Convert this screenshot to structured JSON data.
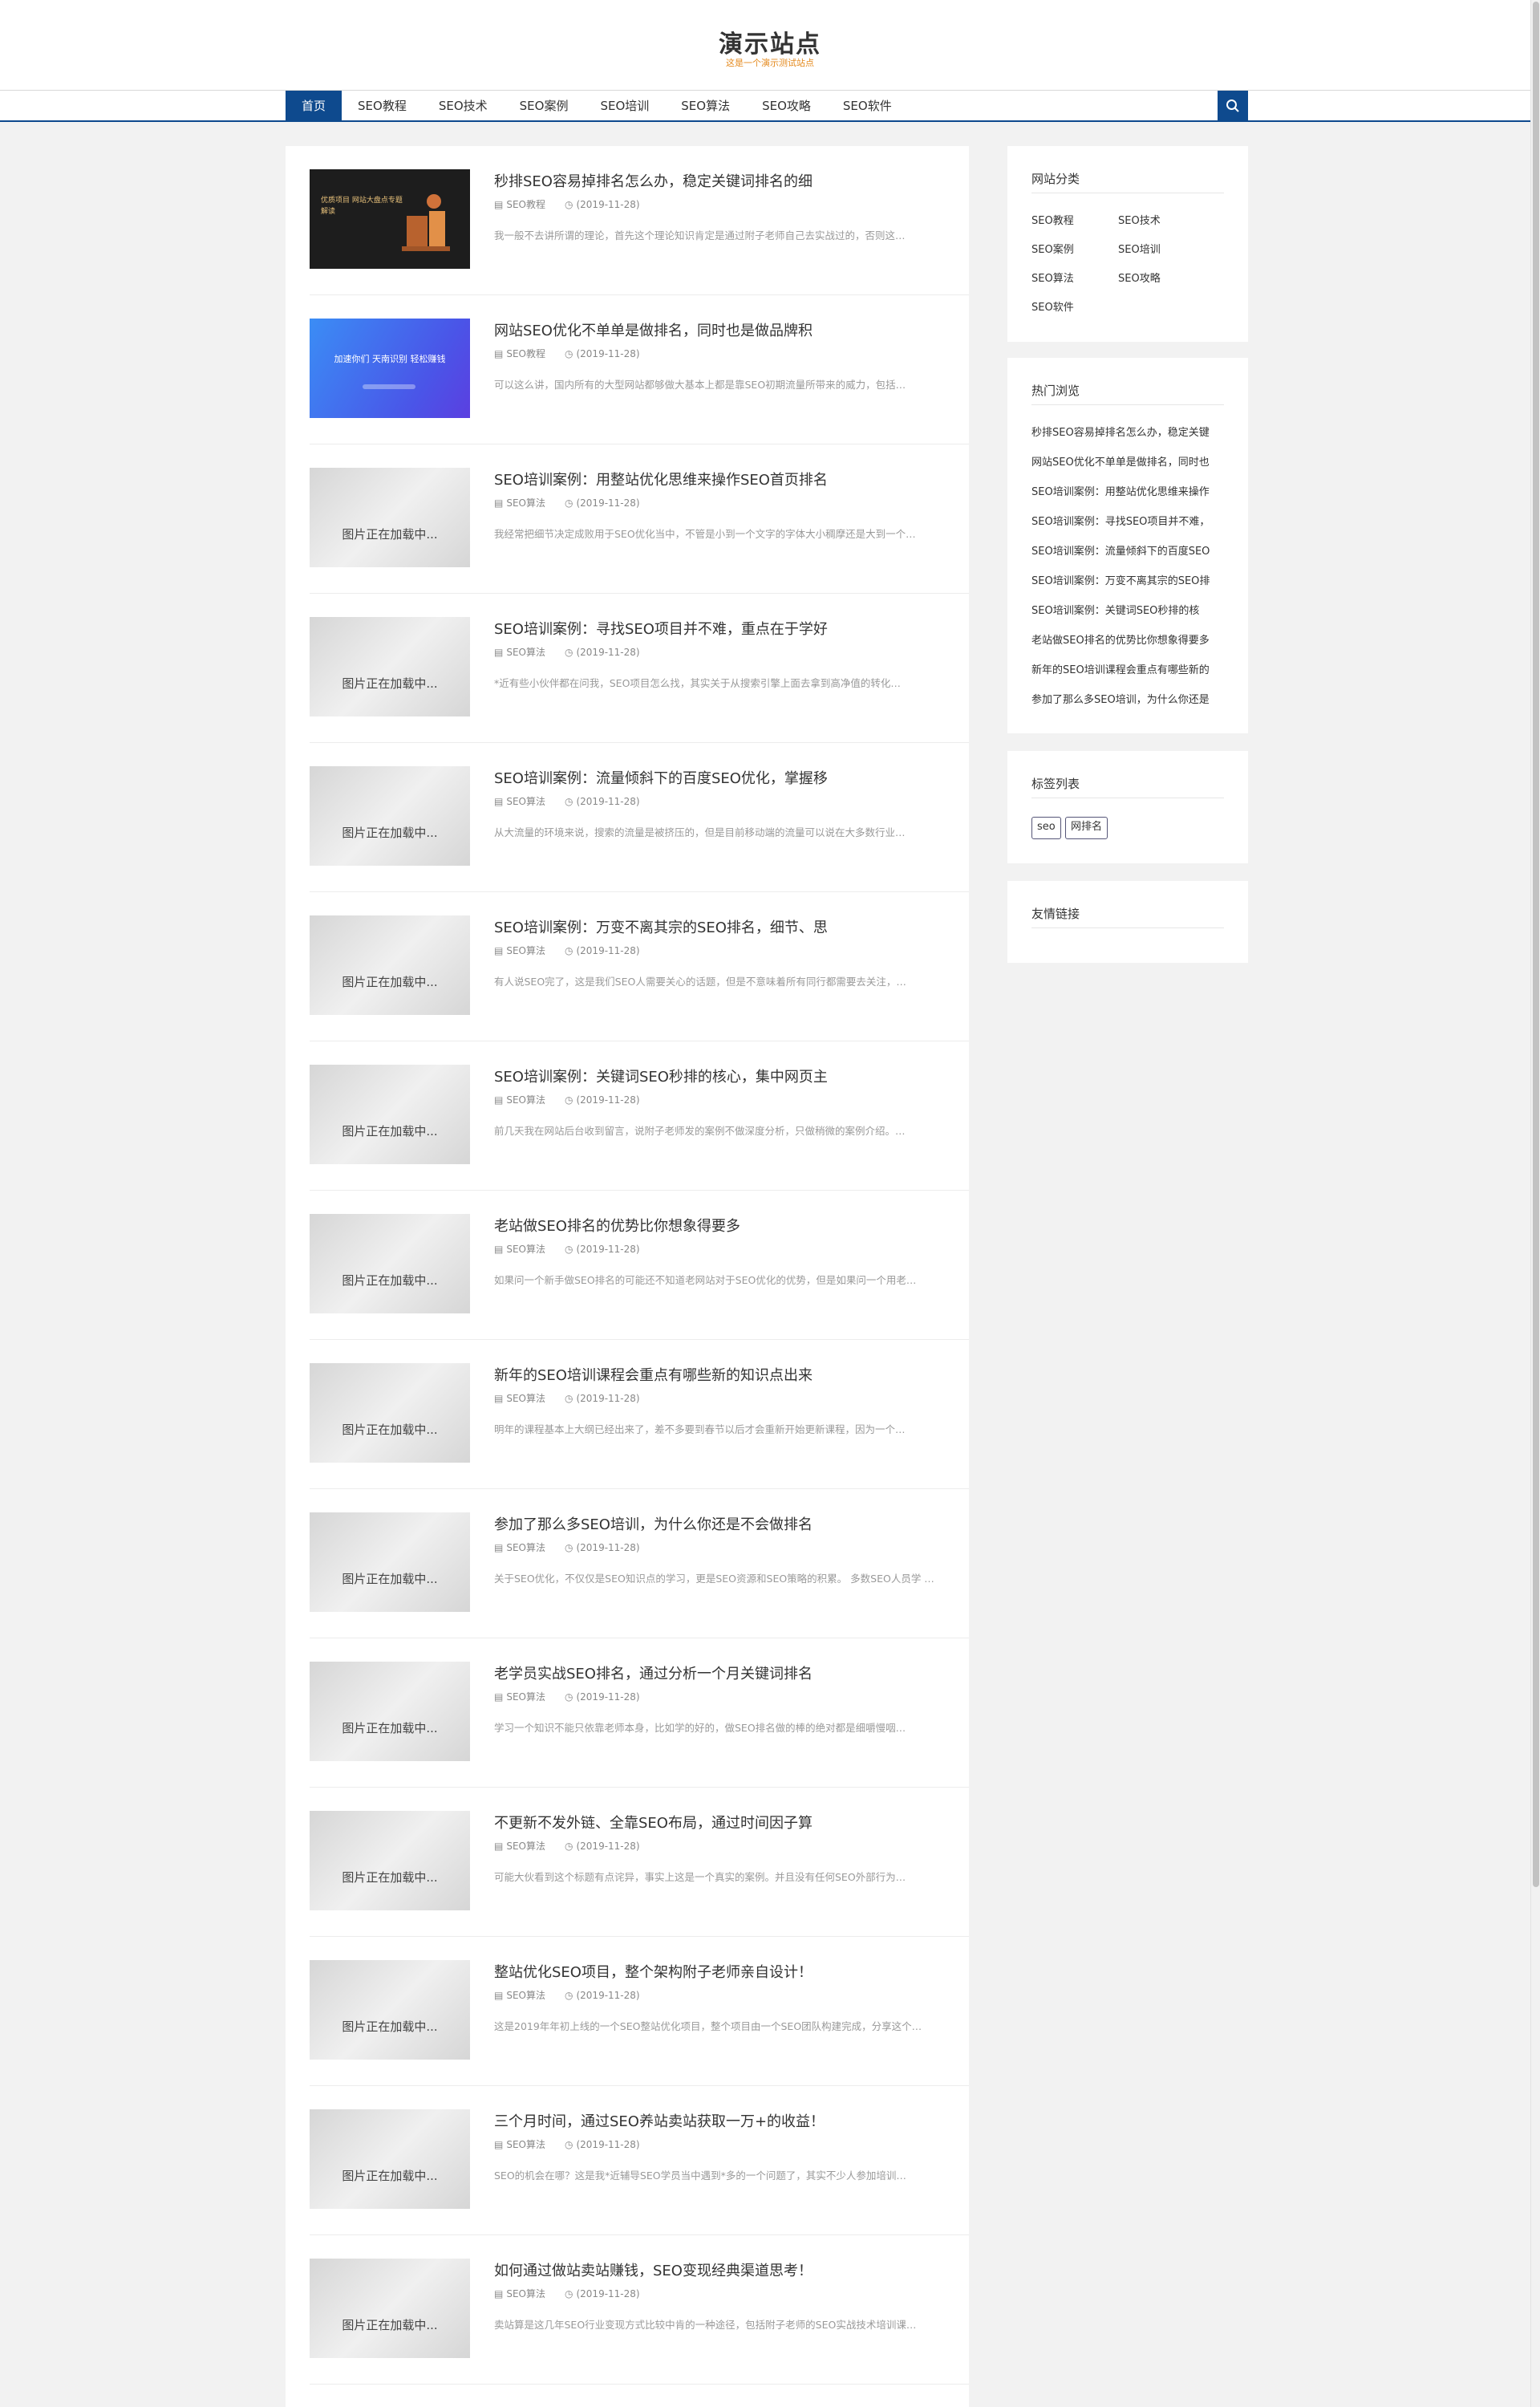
{
  "site": {
    "title": "演示站点",
    "subtitle": "这是一个演示测试站点"
  },
  "nav": {
    "items": [
      "首页",
      "SEO教程",
      "SEO技术",
      "SEO案例",
      "SEO培训",
      "SEO算法",
      "SEO攻略",
      "SEO软件"
    ]
  },
  "thumbs": {
    "loading_text": "图片正在加载中...",
    "t1_text": "优质项目 网站大盘点专题解读",
    "t2_text": "加速你们 天南识别 轻松赚钱"
  },
  "articles": [
    {
      "title": "秒排SEO容易掉排名怎么办，稳定关键词排名的细",
      "category": "SEO教程",
      "date": "(2019-11-28)",
      "summary": "我一般不去讲所谓的理论，首先这个理论知识肯定是通过附子老师自己去实战过的，否则这…"
    },
    {
      "title": "网站SEO优化不单单是做排名，同时也是做品牌积",
      "category": "SEO教程",
      "date": "(2019-11-28)",
      "summary": "可以这么讲，国内所有的大型网站都够做大基本上都是靠SEO初期流量所带来的威力，包括…"
    },
    {
      "title": "SEO培训案例：用整站优化思维来操作SEO首页排名",
      "category": "SEO算法",
      "date": "(2019-11-28)",
      "summary": "我经常把细节决定成败用于SEO优化当中，不管是小到一个文字的字体大小稠摩还是大到一个…"
    },
    {
      "title": "SEO培训案例：寻找SEO项目并不难，重点在于学好",
      "category": "SEO算法",
      "date": "(2019-11-28)",
      "summary": "*近有些小伙伴都在问我，SEO项目怎么找，其实关于从搜索引擎上面去拿到高净值的转化…"
    },
    {
      "title": "SEO培训案例：流量倾斜下的百度SEO优化，掌握移",
      "category": "SEO算法",
      "date": "(2019-11-28)",
      "summary": "从大流量的环境来说，搜索的流量是被挤压的，但是目前移动端的流量可以说在大多数行业…"
    },
    {
      "title": "SEO培训案例：万变不离其宗的SEO排名，细节、思",
      "category": "SEO算法",
      "date": "(2019-11-28)",
      "summary": "有人说SEO完了，这是我们SEO人需要关心的话题，但是不意味着所有同行都需要去关注，…"
    },
    {
      "title": "SEO培训案例：关键词SEO秒排的核心，集中网页主",
      "category": "SEO算法",
      "date": "(2019-11-28)",
      "summary": "前几天我在网站后台收到留言，说附子老师发的案例不做深度分析，只做稍微的案例介绍。…"
    },
    {
      "title": "老站做SEO排名的优势比你想象得要多",
      "category": "SEO算法",
      "date": "(2019-11-28)",
      "summary": "如果问一个新手做SEO排名的可能还不知道老网站对于SEO优化的优势，但是如果问一个用老…"
    },
    {
      "title": "新年的SEO培训课程会重点有哪些新的知识点出来",
      "category": "SEO算法",
      "date": "(2019-11-28)",
      "summary": "明年的课程基本上大纲已经出来了，差不多要到春节以后才会重新开始更新课程，因为一个…"
    },
    {
      "title": "参加了那么多SEO培训，为什么你还是不会做排名",
      "category": "SEO算法",
      "date": "(2019-11-28)",
      "summary": "关于SEO优化，不仅仅是SEO知识点的学习，更是SEO资源和SEO策略的积累。 多数SEO人员学 …"
    },
    {
      "title": "老学员实战SEO排名，通过分析一个月关键词排名",
      "category": "SEO算法",
      "date": "(2019-11-28)",
      "summary": "学习一个知识不能只依靠老师本身，比如学的好的，做SEO排名做的棒的绝对都是细嚼慢咽…"
    },
    {
      "title": "不更新不发外链、全靠SEO布局，通过时间因子算",
      "category": "SEO算法",
      "date": "(2019-11-28)",
      "summary": "可能大伙看到这个标题有点诧异，事实上这是一个真实的案例。并且没有任何SEO外部行为…"
    },
    {
      "title": "整站优化SEO项目，整个架构附子老师亲自设计！",
      "category": "SEO算法",
      "date": "(2019-11-28)",
      "summary": "这是2019年年初上线的一个SEO整站优化项目，整个项目由一个SEO团队构建完成，分享这个…"
    },
    {
      "title": "三个月时间，通过SEO养站卖站获取一万+的收益！",
      "category": "SEO算法",
      "date": "(2019-11-28)",
      "summary": "SEO的机会在哪？这是我*近辅导SEO学员当中遇到*多的一个问题了，其实不少人参加培训…"
    },
    {
      "title": "如何通过做站卖站赚钱，SEO变现经典渠道思考！",
      "category": "SEO算法",
      "date": "(2019-11-28)",
      "summary": "卖站算是这几年SEO行业变现方式比较中肯的一种途径，包括附子老师的SEO实战技术培训课…"
    }
  ],
  "sidebar": {
    "categories": {
      "title": "网站分类",
      "items": [
        "SEO教程",
        "SEO技术",
        "SEO案例",
        "SEO培训",
        "SEO算法",
        "SEO攻略",
        "SEO软件"
      ]
    },
    "hot": {
      "title": "热门浏览",
      "items": [
        "秒排SEO容易掉排名怎么办，稳定关键",
        "网站SEO优化不单单是做排名，同时也",
        "SEO培训案例：用整站优化思维来操作",
        "SEO培训案例：寻找SEO项目并不难，",
        "SEO培训案例：流量倾斜下的百度SEO",
        "SEO培训案例：万变不离其宗的SEO排",
        "SEO培训案例：关键词SEO秒排的核",
        "老站做SEO排名的优势比你想象得要多",
        "新年的SEO培训课程会重点有哪些新的",
        "参加了那么多SEO培训，为什么你还是"
      ]
    },
    "tags": {
      "title": "标签列表",
      "items": [
        "seo",
        "网排名"
      ]
    },
    "links": {
      "title": "友情链接"
    }
  },
  "colors": {
    "brand": "#0e4a8e",
    "subtitle": "#e4891d"
  },
  "icons": {
    "search": "search-icon",
    "category": "folder-icon",
    "date": "clock-icon"
  }
}
